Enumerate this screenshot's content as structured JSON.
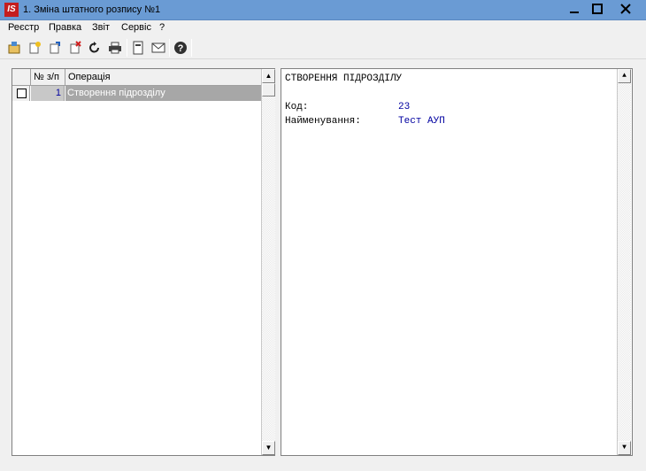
{
  "window": {
    "app_icon_text": "IS",
    "title": "1. Зміна штатного розпису №1"
  },
  "menu": [
    "Реєстр",
    "Правка",
    "Звіт",
    "Сервіс",
    "?"
  ],
  "toolbar_icons": [
    "open-icon",
    "new-icon",
    "copy-icon",
    "delete-icon",
    "refresh-icon",
    "print-icon",
    "page-icon",
    "mail-icon",
    "help-icon"
  ],
  "grid": {
    "columns": [
      "№ з/п",
      "Операція"
    ],
    "rows": [
      {
        "num": "1",
        "operation": "Створення підрозділу"
      }
    ]
  },
  "detail": {
    "heading": "СТВОРЕННЯ ПІДРОЗДІЛУ",
    "fields": [
      {
        "label": "Код:",
        "value": "23"
      },
      {
        "label": "Найменування:",
        "value": "Тест АУП"
      }
    ]
  }
}
